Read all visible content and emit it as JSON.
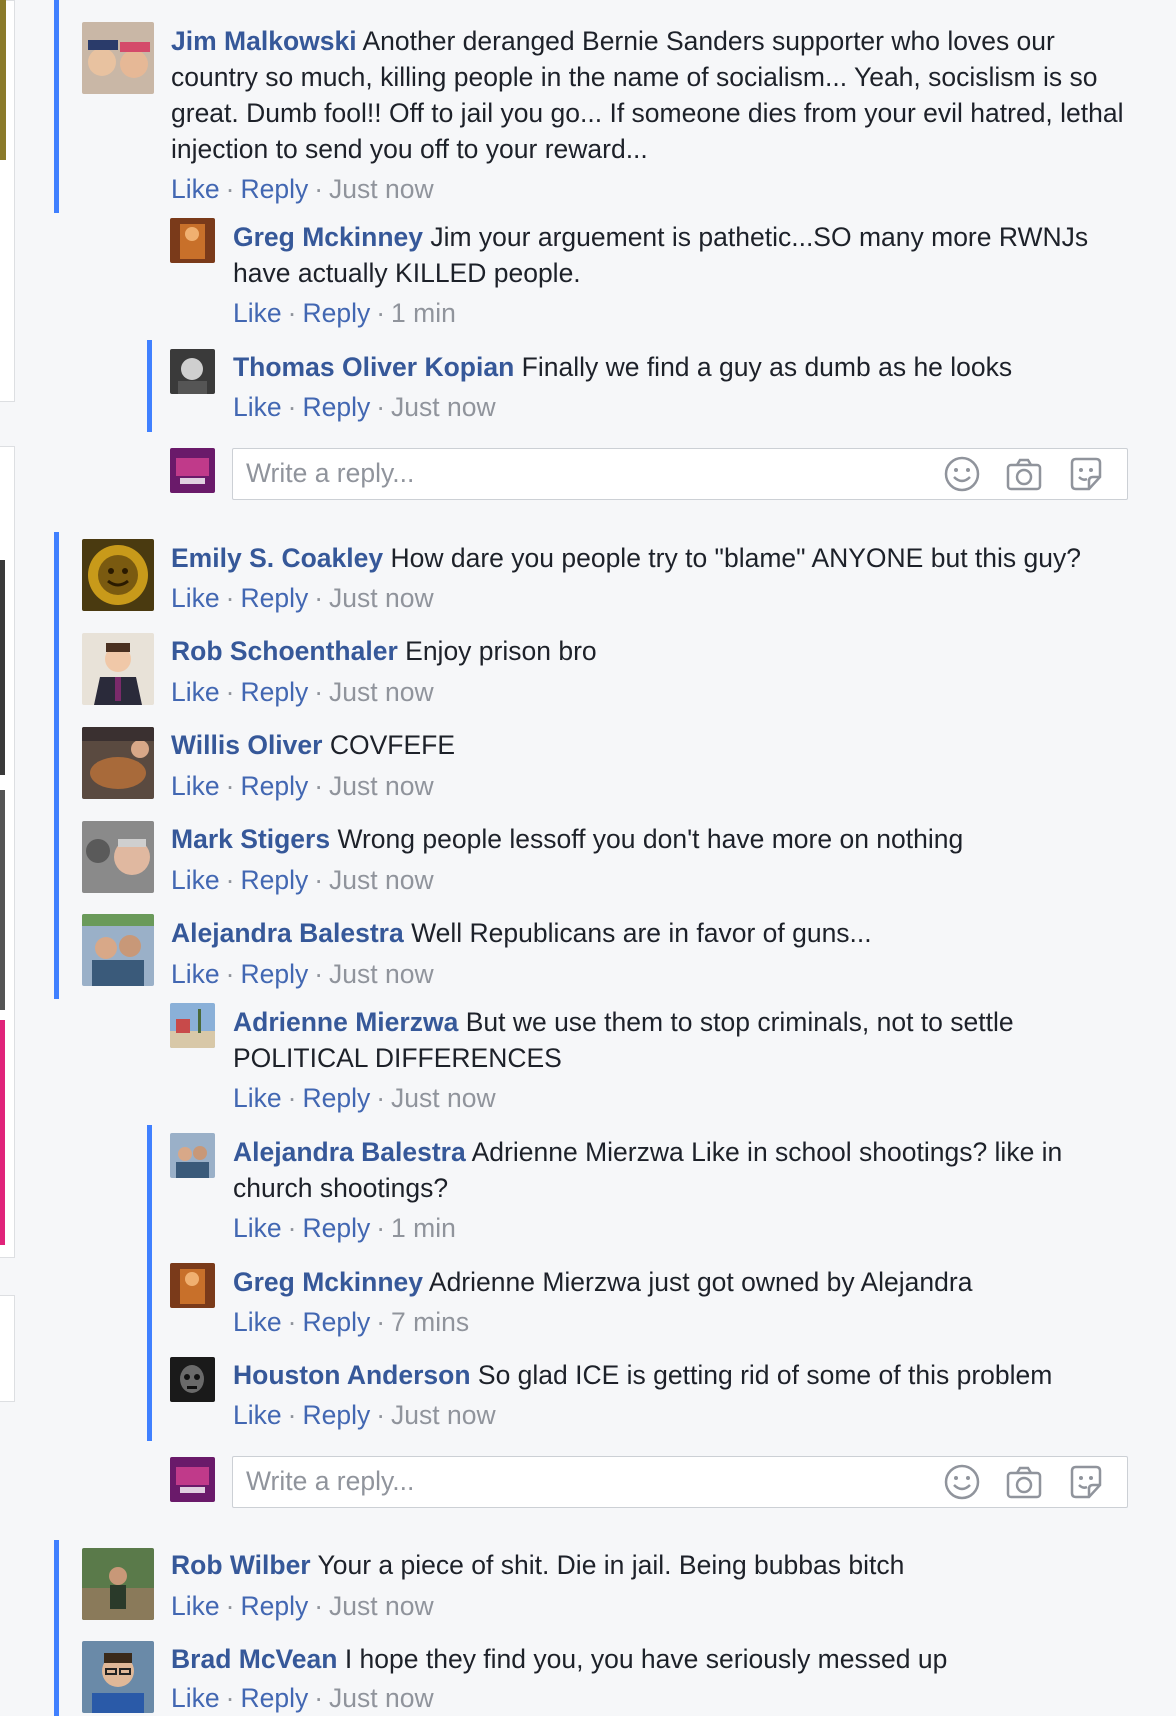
{
  "colors": {
    "link": "#365899",
    "meta": "#90949c",
    "accent": "#4080ff",
    "action": "#4267b2"
  },
  "comments": [
    {
      "name": "Jim Malkowski",
      "text": "Another deranged Bernie Sanders supporter who loves our",
      "lines": [
        "country so much, killing people in the name of socialism... Yeah, socislism is so",
        "great. Dumb fool!! Off to jail you go... If someone dies from your evil hatred, lethal",
        "injection to send you off to your reward..."
      ],
      "like": "Like",
      "reply": "Reply",
      "time": "Just now"
    },
    {
      "name": "Greg Mckinney",
      "text": "Jim your arguement is pathetic...SO many more RWNJs",
      "lines": [
        "have actually KILLED people."
      ],
      "like": "Like",
      "reply": "Reply",
      "time": "1 min"
    },
    {
      "name": "Thomas Oliver Kopian",
      "text": "Finally we find a guy as dumb as he looks",
      "like": "Like",
      "reply": "Reply",
      "time": "Just now"
    },
    {
      "name": "Emily S. Coakley",
      "text": "How dare you people try to \"blame\" ANYONE but this guy?",
      "like": "Like",
      "reply": "Reply",
      "time": "Just now"
    },
    {
      "name": "Rob Schoenthaler",
      "text": "Enjoy prison bro",
      "like": "Like",
      "reply": "Reply",
      "time": "Just now"
    },
    {
      "name": "Willis Oliver",
      "text": "COVFEFE",
      "like": "Like",
      "reply": "Reply",
      "time": "Just now"
    },
    {
      "name": "Mark Stigers",
      "text": "Wrong people lessoff you don't have more on nothing",
      "like": "Like",
      "reply": "Reply",
      "time": "Just now"
    },
    {
      "name": "Alejandra Balestra",
      "text": "Well Republicans are in favor of guns...",
      "like": "Like",
      "reply": "Reply",
      "time": "Just now"
    },
    {
      "name": "Adrienne Mierzwa",
      "text": "But we use them to stop criminals, not to settle",
      "lines": [
        "POLITICAL DIFFERENCES"
      ],
      "like": "Like",
      "reply": "Reply",
      "time": "Just now"
    },
    {
      "name": "Alejandra Balestra",
      "text": "Adrienne Mierzwa Like in school shootings? like in",
      "lines": [
        "church shootings?"
      ],
      "like": "Like",
      "reply": "Reply",
      "time": "1 min"
    },
    {
      "name": "Greg Mckinney",
      "text": "Adrienne Mierzwa just got owned by Alejandra",
      "like": "Like",
      "reply": "Reply",
      "time": "7 mins"
    },
    {
      "name": "Houston Anderson",
      "text": "So glad ICE is getting rid of some of this problem",
      "like": "Like",
      "reply": "Reply",
      "time": "Just now"
    },
    {
      "name": "Rob Wilber",
      "text": "Your a piece of shit. Die in jail. Being bubbas bitch",
      "like": "Like",
      "reply": "Reply",
      "time": "Just now"
    },
    {
      "name": "Brad McVean",
      "text": "I hope they find you, you have seriously messed up",
      "like": "Like",
      "reply": "Reply",
      "time": "Just now"
    }
  ],
  "reply_boxes": [
    {
      "placeholder": "Write a reply...",
      "icons": [
        "smiley-icon",
        "camera-icon",
        "sticker-icon"
      ]
    },
    {
      "placeholder": "Write a reply...",
      "icons": [
        "smiley-icon",
        "camera-icon",
        "sticker-icon"
      ]
    }
  ]
}
